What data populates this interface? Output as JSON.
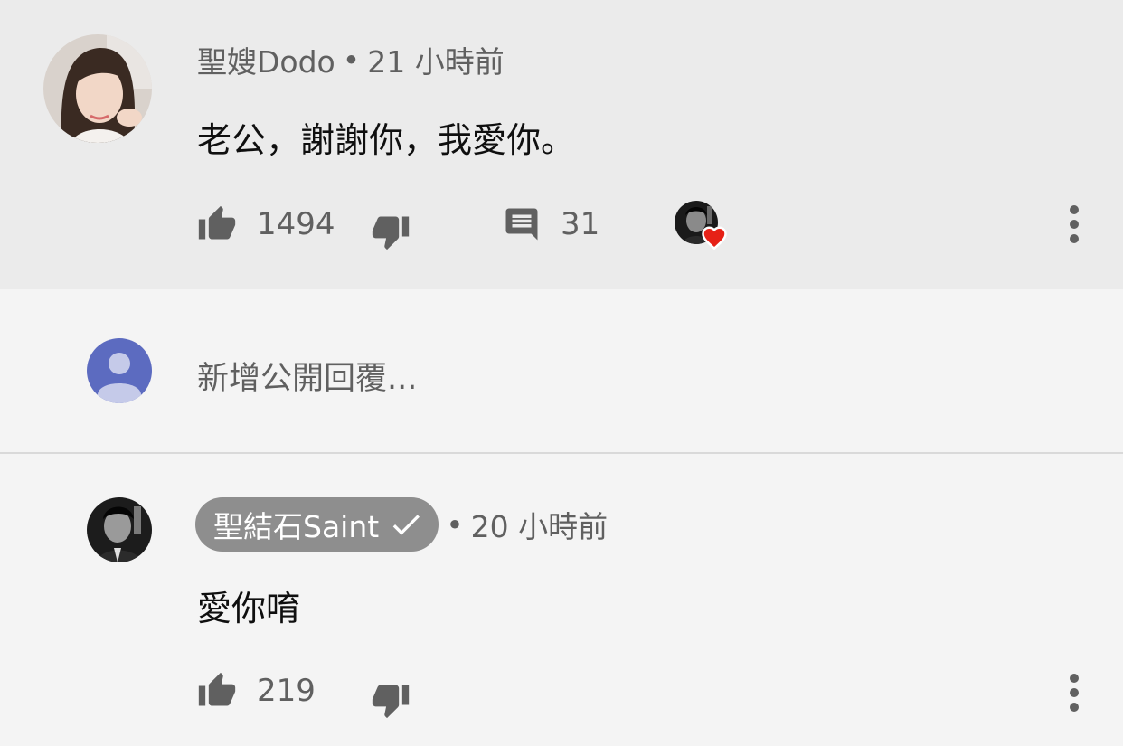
{
  "top_comment": {
    "author": "聖嫂Dodo",
    "separator": "•",
    "time": "21 小時前",
    "text": "老公，謝謝你，我愛你。",
    "like_count": "1494",
    "reply_count": "31",
    "icons": {
      "like": "thumb-up-icon",
      "dislike": "thumb-down-icon",
      "reply": "comment-icon",
      "heart": "creator-heart-icon",
      "more": "more-vert-icon"
    }
  },
  "reply_input": {
    "placeholder": "新增公開回覆..."
  },
  "reply": {
    "author": "聖結石Saint",
    "separator": "•",
    "time": "20 小時前",
    "text": "愛你唷",
    "like_count": "219",
    "verified": true
  },
  "colors": {
    "top_background": "#ebebeb",
    "page_background": "#f4f4f4",
    "icon_gray": "#606060",
    "badge_gray": "#8e8e8e",
    "heart_red": "#e62117",
    "placeholder_avatar": "#5c6bc0"
  }
}
